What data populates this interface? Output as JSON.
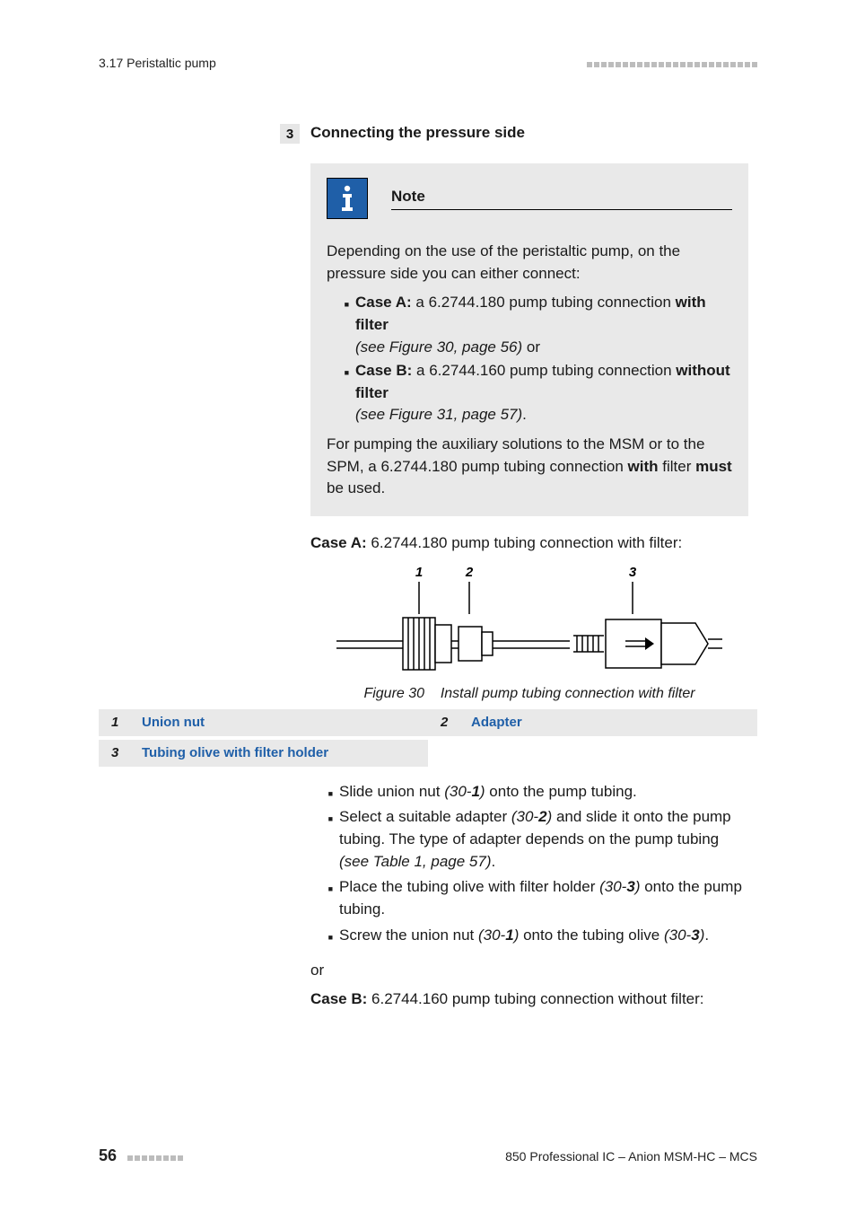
{
  "header": {
    "section": "3.17 Peristaltic pump"
  },
  "step": {
    "num": "3",
    "title": "Connecting the pressure side"
  },
  "note": {
    "title": "Note",
    "intro": "Depending on the use of the peristaltic pump, on the pressure side you can either connect:",
    "caseA_label": "Case A:",
    "caseA_text1": " a 6.2744.180 pump tubing connection ",
    "caseA_bold": "with filter",
    "caseA_ref": "(see Figure 30, page 56)",
    "caseA_or": " or",
    "caseB_label": "Case B:",
    "caseB_text1": " a 6.2744.160 pump tubing connection ",
    "caseB_bold": "without filter",
    "caseB_ref": "(see Figure 31, page 57)",
    "outro1": "For pumping the auxiliary solutions to the MSM or to the SPM, a 6.2744.180 pump tubing connection ",
    "outro_with": "with",
    "outro_filter": " filter ",
    "outro_must": "must",
    "outro2": " be used."
  },
  "caseA_heading_label": "Case A:",
  "caseA_heading_text": " 6.2744.180 pump tubing connection with filter:",
  "figure": {
    "labels": {
      "l1": "1",
      "l2": "2",
      "l3": "3"
    },
    "caption_prefix": "Figure 30",
    "caption_text": "Install pump tubing connection with filter"
  },
  "legend": {
    "n1": "1",
    "t1": "Union nut",
    "n2": "2",
    "t2": "Adapter",
    "n3": "3",
    "t3": "Tubing olive with filter holder"
  },
  "steps": {
    "s1a": "Slide union nut ",
    "s1r": "(30-",
    "s1rb": "1",
    "s1b": ") ",
    "s1c": "onto the pump tubing.",
    "s2a": "Select a suitable adapter ",
    "s2r": "(30-",
    "s2rb": "2",
    "s2b": ") ",
    "s2c": "and slide it onto the pump tubing. The type of adapter depends on the pump tubing ",
    "s2ref": "(see Table 1, page 57)",
    "s3a": "Place the tubing olive with filter holder ",
    "s3r": "(30-",
    "s3rb": "3",
    "s3b": ") ",
    "s3c": "onto the pump tubing.",
    "s4a": "Screw the union nut ",
    "s4r1": "(30-",
    "s4rb1": "1",
    "s4b1": ") ",
    "s4c": "onto the tubing olive ",
    "s4r2": "(30-",
    "s4rb2": "3",
    "s4b2": ")"
  },
  "or": "or",
  "caseB_heading_label": "Case B:",
  "caseB_heading_text": " 6.2744.160 pump tubing connection without filter:",
  "footer": {
    "page": "56",
    "right": "850 Professional IC – Anion MSM-HC – MCS"
  }
}
